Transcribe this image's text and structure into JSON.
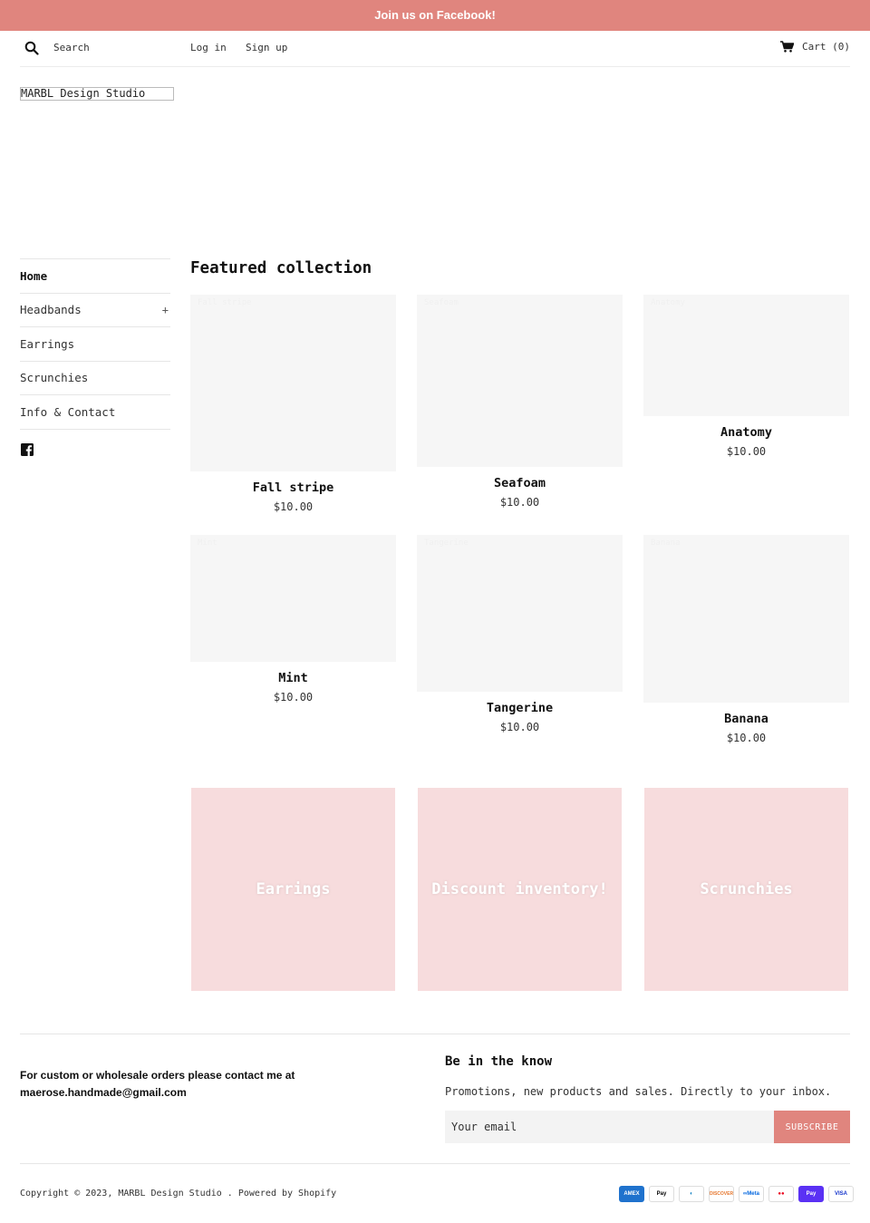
{
  "announcement": "Join us on Facebook!",
  "header": {
    "search_placeholder": "Search",
    "login": "Log in",
    "signup": "Sign up",
    "cart": "Cart (0)"
  },
  "logo": "MARBL Design Studio",
  "sidenav": {
    "items": [
      {
        "label": "Home"
      },
      {
        "label": "Headbands",
        "expand": "+"
      },
      {
        "label": "Earrings"
      },
      {
        "label": "Scrunchies"
      },
      {
        "label": "Info & Contact"
      }
    ]
  },
  "featured": {
    "title": "Featured collection",
    "products": [
      {
        "name": "Fall stripe",
        "price": "$10.00",
        "img_label": "Fall stripe"
      },
      {
        "name": "Seafoam",
        "price": "$10.00",
        "img_label": "Seafoam"
      },
      {
        "name": "Anatomy",
        "price": "$10.00",
        "img_label": "Anatomy"
      },
      {
        "name": "Mint",
        "price": "$10.00",
        "img_label": "Mint"
      },
      {
        "name": "Tangerine",
        "price": "$10.00",
        "img_label": "Tangerine"
      },
      {
        "name": "Banana",
        "price": "$10.00",
        "img_label": "Banana"
      }
    ]
  },
  "collections": [
    {
      "label": "Earrings"
    },
    {
      "label": "Discount inventory!"
    },
    {
      "label": "Scrunchies"
    }
  ],
  "footer": {
    "custom_note": "For custom or wholesale orders please contact me at maerose.handmade@gmail.com",
    "newsletter_title": "Be in the know",
    "newsletter_sub": "Promotions, new products and sales. Directly to your inbox.",
    "email_placeholder": "Your email",
    "subscribe": "SUBSCRIBE",
    "copyright": "Copyright © 2023, MARBL Design Studio . Powered by Shopify",
    "payments": [
      {
        "name": "American Express",
        "label": "AMEX",
        "bg": "#1f72cd",
        "fg": "#ffffff"
      },
      {
        "name": "Apple Pay",
        "label": "Pay",
        "bg": "#ffffff",
        "fg": "#000000"
      },
      {
        "name": "Diners Club",
        "label": "◐",
        "bg": "#ffffff",
        "fg": "#0079be"
      },
      {
        "name": "Discover",
        "label": "DISCOVER",
        "bg": "#ffffff",
        "fg": "#e6772e"
      },
      {
        "name": "Meta Pay",
        "label": "∞Meta",
        "bg": "#ffffff",
        "fg": "#0467df"
      },
      {
        "name": "Mastercard",
        "label": "●●",
        "bg": "#ffffff",
        "fg": "#eb001b"
      },
      {
        "name": "Shop Pay",
        "label": "Pay",
        "bg": "#5a31f4",
        "fg": "#ffffff"
      },
      {
        "name": "Visa",
        "label": "VISA",
        "bg": "#ffffff",
        "fg": "#1434cb"
      }
    ]
  },
  "colors": {
    "accent": "#e0857e",
    "collection_tile": "#f7dcdd",
    "product_placeholder": "#f6f6f6"
  }
}
